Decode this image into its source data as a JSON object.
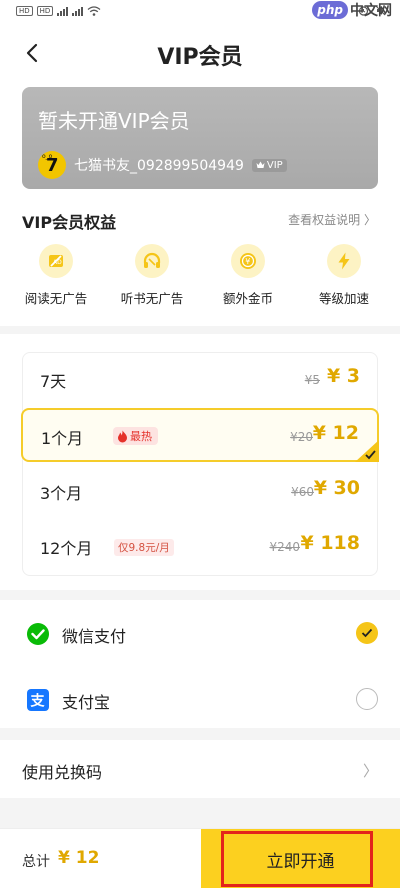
{
  "status_bar": {
    "watermark_logo": "php",
    "watermark_text": "中文网"
  },
  "header": {
    "title": "VIP会员",
    "back_icon": "chevron-left-icon"
  },
  "vip_card": {
    "status_text": "暂未开通VIP会员",
    "username": "七猫书友_092899504949",
    "badge": "VIP"
  },
  "rights": {
    "title": "VIP会员权益",
    "link": "查看权益说明 〉",
    "items": [
      {
        "label": "阅读无广告",
        "icon": "no-ads-book-icon"
      },
      {
        "label": "听书无广告",
        "icon": "headphones-icon"
      },
      {
        "label": "额外金币",
        "icon": "coin-icon"
      },
      {
        "label": "等级加速",
        "icon": "lightning-icon"
      }
    ]
  },
  "plans": [
    {
      "name": "7天",
      "old_price": "¥5",
      "price": "¥ 3"
    },
    {
      "name": "1个月",
      "tag": "最热",
      "old_price": "¥20",
      "price": "¥ 12",
      "selected": true
    },
    {
      "name": "3个月",
      "old_price": "¥60",
      "price": "¥ 30"
    },
    {
      "name": "12个月",
      "note": "仅9.8元/月",
      "old_price": "¥240",
      "price": "¥ 118"
    }
  ],
  "payment": {
    "options": [
      {
        "name": "微信支付",
        "icon": "wechat-pay-icon",
        "selected": true
      },
      {
        "name": "支付宝",
        "icon": "alipay-icon",
        "selected": false
      }
    ]
  },
  "redeem": {
    "label": "使用兑换码"
  },
  "footer": {
    "total_label": "总计",
    "total_value": "¥ 12",
    "buy_label": "立即开通"
  },
  "colors": {
    "accent": "#fcd01f",
    "price": "#e0a800",
    "hot": "#e5312a",
    "highlight_box": "#e3241b"
  }
}
